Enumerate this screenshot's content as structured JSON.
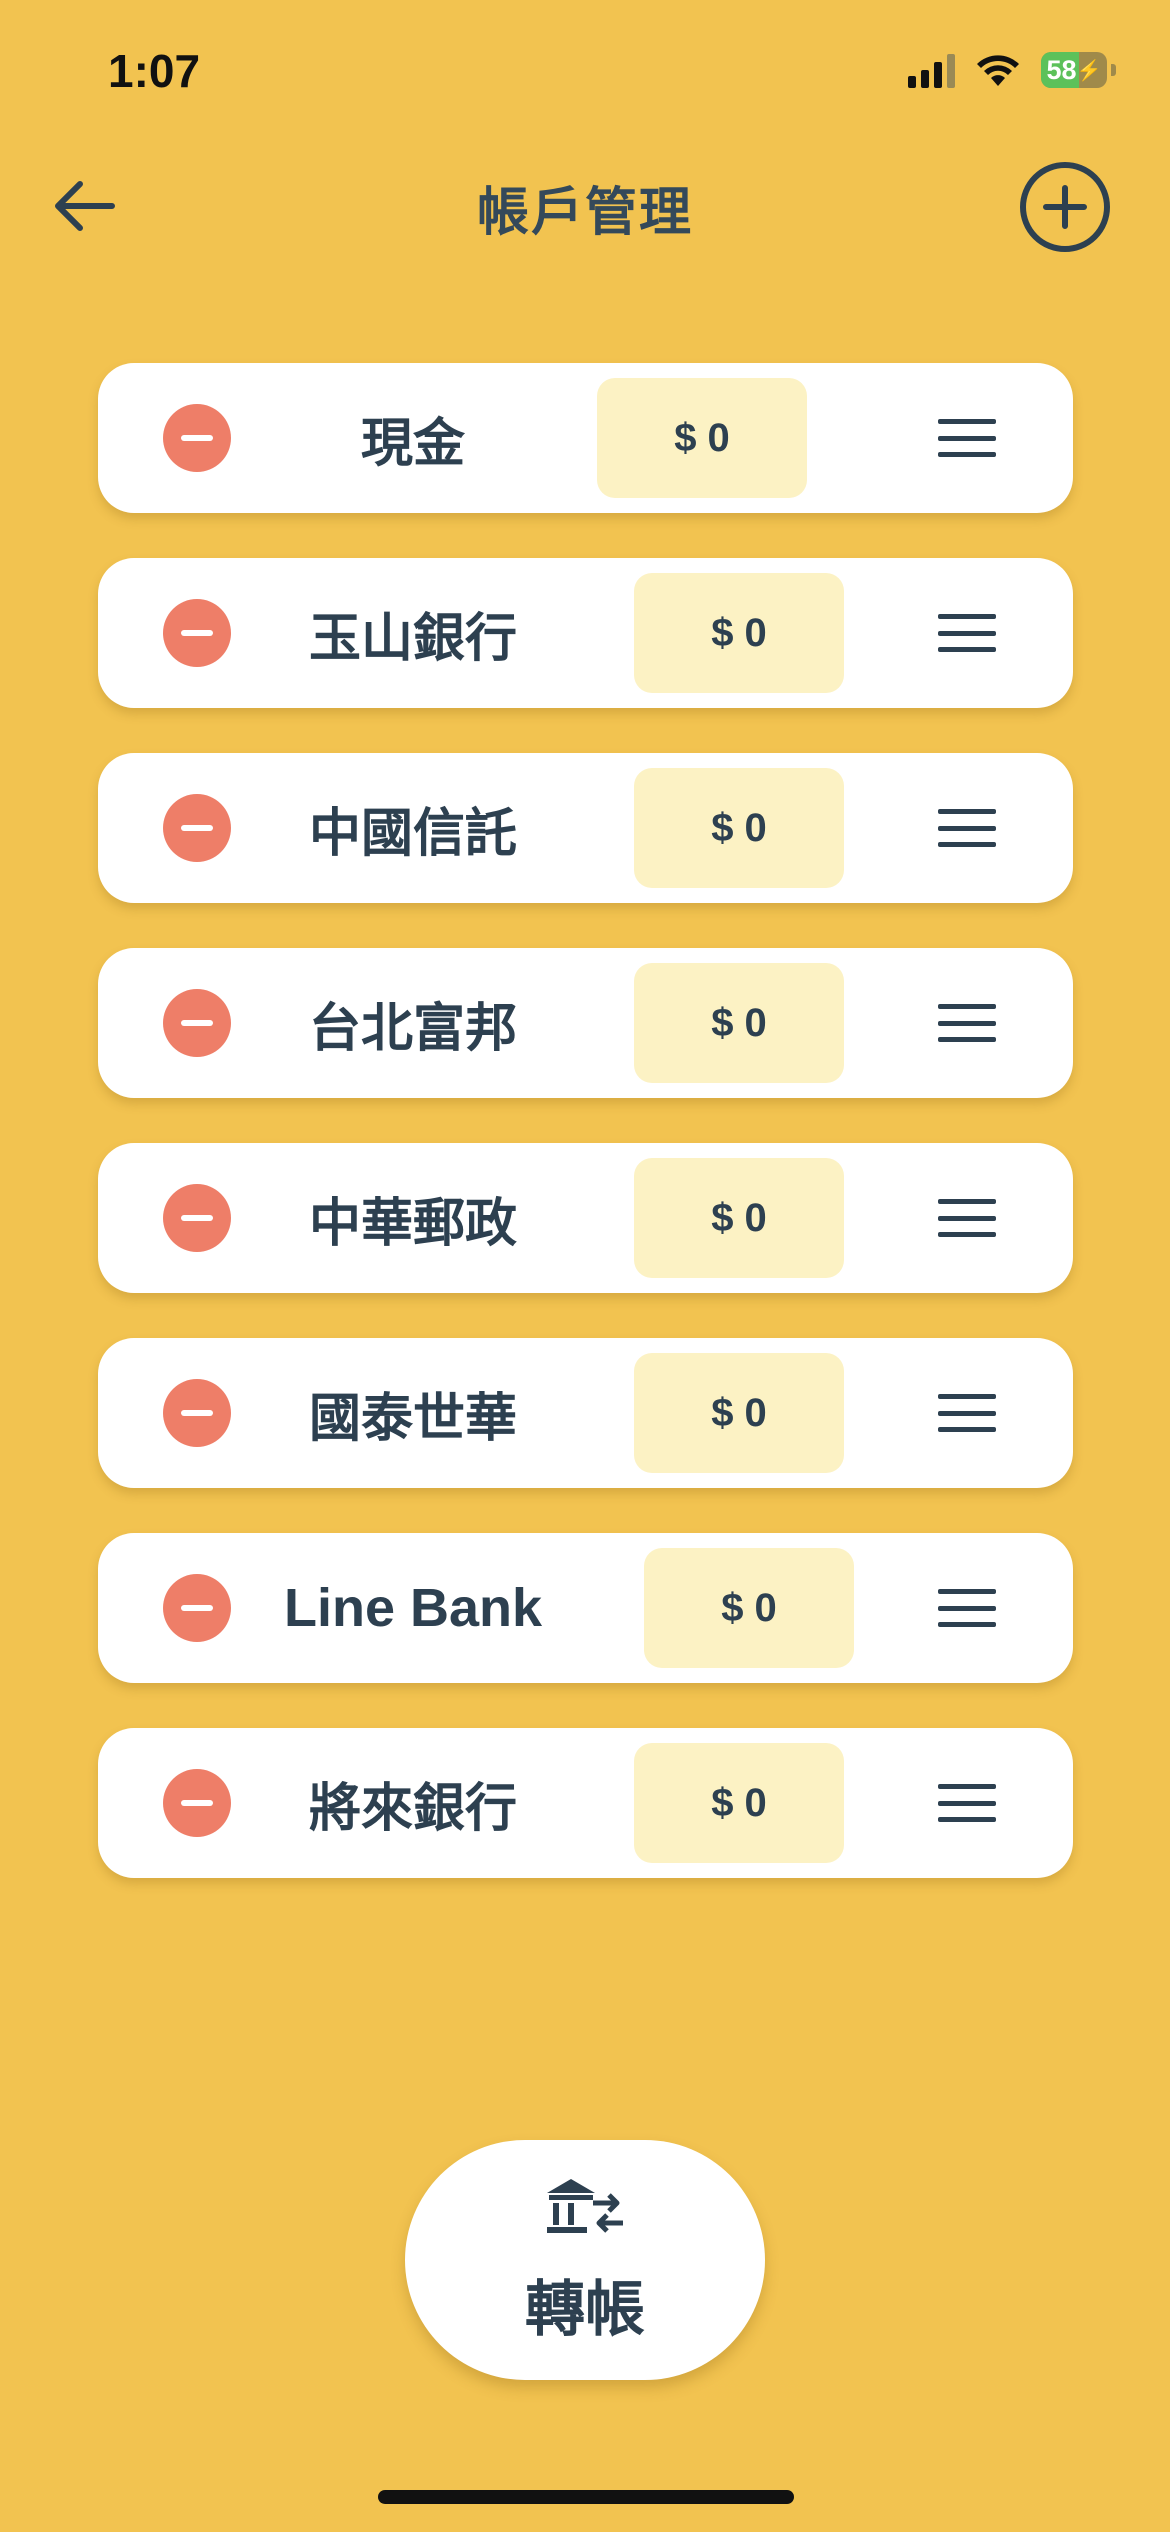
{
  "status_bar": {
    "time": "1:07",
    "battery_percent": "58",
    "signal_bars": 3
  },
  "header": {
    "title": "帳戶管理",
    "back_icon": "arrow-left-icon",
    "add_icon": "plus-circle-icon"
  },
  "accounts": [
    {
      "name": "現金",
      "balance": "$ 0"
    },
    {
      "name": "玉山銀行",
      "balance": "$ 0"
    },
    {
      "name": "中國信託",
      "balance": "$ 0"
    },
    {
      "name": "台北富邦",
      "balance": "$ 0"
    },
    {
      "name": "中華郵政",
      "balance": "$ 0"
    },
    {
      "name": "國泰世華",
      "balance": "$ 0"
    },
    {
      "name": "Line Bank",
      "balance": "$ 0"
    },
    {
      "name": "將來銀行",
      "balance": "$ 0"
    }
  ],
  "transfer": {
    "label": "轉帳",
    "icon": "bank-transfer-icon"
  },
  "colors": {
    "background": "#F2C350",
    "text": "#2D4050",
    "remove": "#EE7E68",
    "balance_bg": "#FCF2C4",
    "card": "#FFFFFF"
  }
}
